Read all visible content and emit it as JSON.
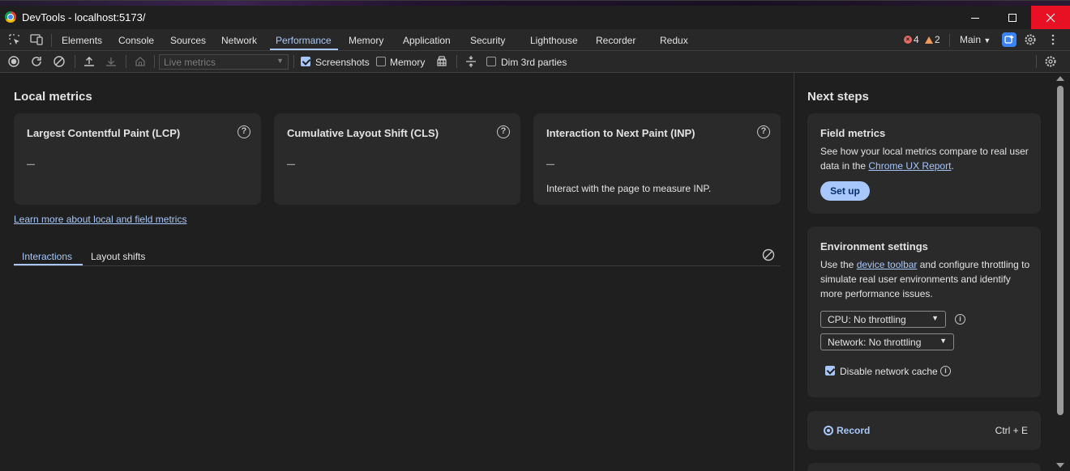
{
  "window": {
    "title": "DevTools - localhost:5173/",
    "close_color": "#e81123"
  },
  "tabs": [
    {
      "label": "Elements"
    },
    {
      "label": "Console"
    },
    {
      "label": "Sources"
    },
    {
      "label": "Network"
    },
    {
      "label": "Performance",
      "active": true
    },
    {
      "label": "Memory"
    },
    {
      "label": "Application"
    },
    {
      "label": "Security"
    },
    {
      "label": "Lighthouse"
    },
    {
      "label": "Recorder"
    },
    {
      "label": "Redux"
    }
  ],
  "status": {
    "errors": "4",
    "warnings": "2",
    "target": "Main"
  },
  "toolbar": {
    "metrics_select": "Live metrics",
    "screenshots_label": "Screenshots",
    "screenshots_checked": true,
    "memory_label": "Memory",
    "memory_checked": false,
    "dim_label": "Dim 3rd parties",
    "dim_checked": false
  },
  "local": {
    "heading": "Local metrics",
    "cards": [
      {
        "title": "Largest Contentful Paint (LCP)",
        "value": "–",
        "note": ""
      },
      {
        "title": "Cumulative Layout Shift (CLS)",
        "value": "–",
        "note": ""
      },
      {
        "title": "Interaction to Next Paint (INP)",
        "value": "–",
        "note": "Interact with the page to measure INP."
      }
    ],
    "learn_link": "Learn more about local and field metrics",
    "subtabs": [
      {
        "label": "Interactions",
        "active": true
      },
      {
        "label": "Layout shifts"
      }
    ]
  },
  "next": {
    "heading": "Next steps",
    "field": {
      "title": "Field metrics",
      "text_before": "See how your local metrics compare to real user data in the ",
      "link": "Chrome UX Report",
      "text_after": ".",
      "button": "Set up"
    },
    "env": {
      "title": "Environment settings",
      "text_before": "Use the ",
      "link": "device toolbar",
      "text_after": " and configure throttling to simulate real user environments and identify more performance issues.",
      "cpu": "CPU: No throttling",
      "network": "Network: No throttling",
      "cache_label": "Disable network cache",
      "cache_checked": true
    },
    "record": {
      "label": "Record",
      "shortcut": "Ctrl + E"
    }
  },
  "colors": {
    "accent": "#a8c7fa",
    "background": "#1f1f1f",
    "card": "#2a2a2a"
  }
}
